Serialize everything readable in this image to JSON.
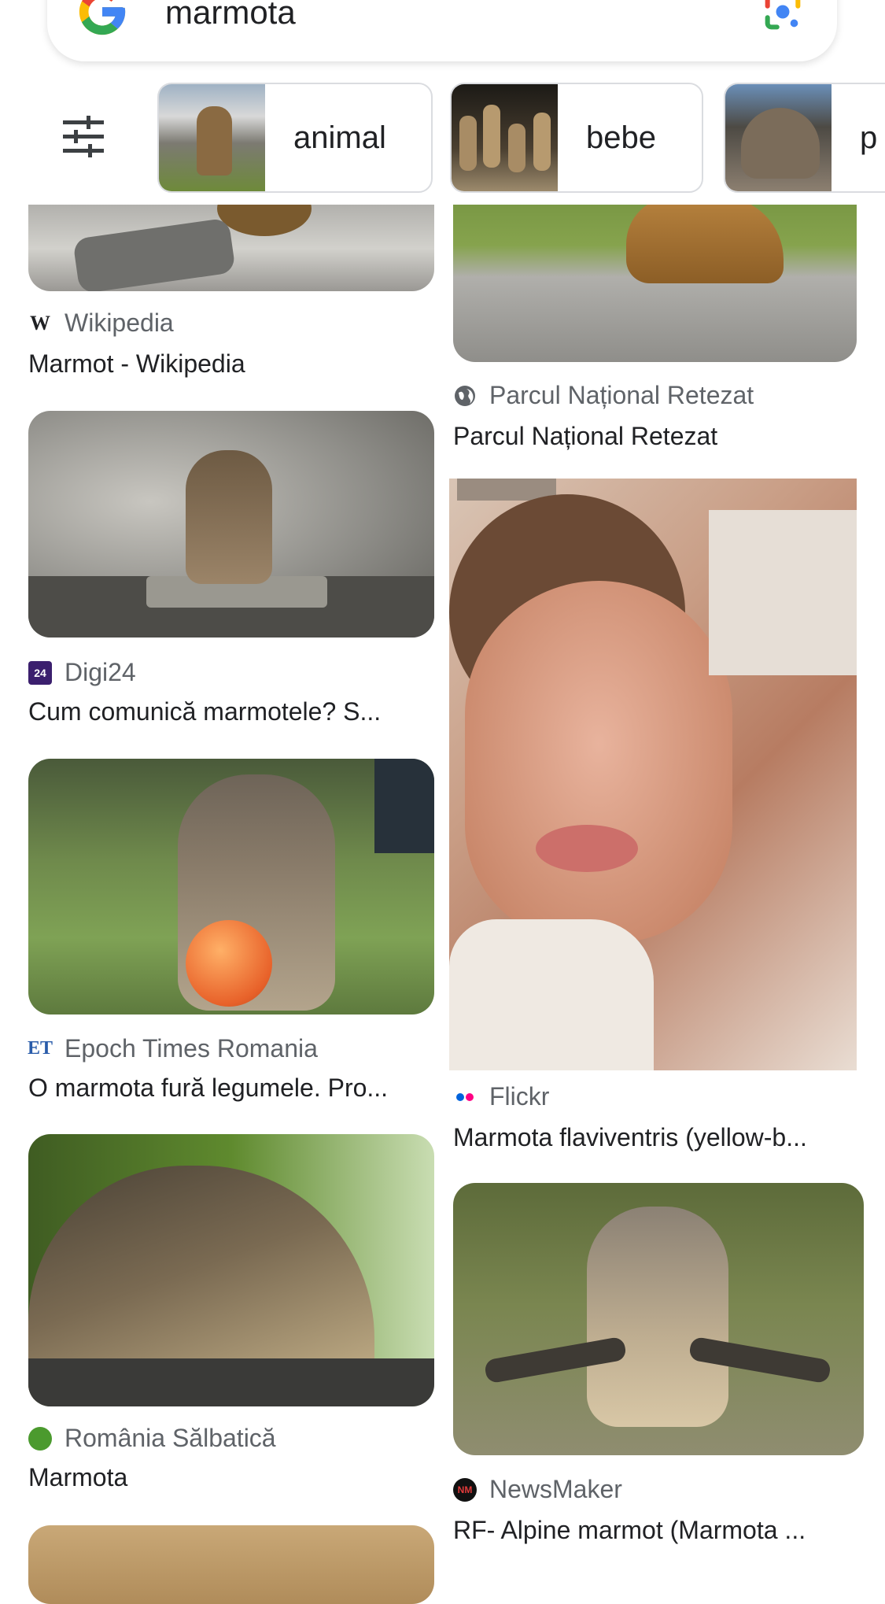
{
  "search": {
    "query": "marmota"
  },
  "chips": [
    {
      "label": "animal"
    },
    {
      "label": "bebe"
    },
    {
      "label": "p"
    }
  ],
  "results": {
    "left": [
      {
        "source": "Wikipedia",
        "title": "Marmot - Wikipedia",
        "source_icon": "wikipedia-icon"
      },
      {
        "source": "Digi24",
        "title": "Cum comunică marmotele? S...",
        "source_icon": "digi24-icon"
      },
      {
        "source": "Epoch Times Romania",
        "title": "O marmota fură legumele. Pro...",
        "source_icon": "epoch-times-icon"
      },
      {
        "source": "România Sălbatică",
        "title": "Marmota",
        "source_icon": "romania-salbatica-icon"
      }
    ],
    "right": [
      {
        "source": "Parcul Național Retezat",
        "title": "Parcul Național Retezat",
        "source_icon": "globe-icon"
      },
      {
        "source": "Flickr",
        "title": "Marmota flaviventris (yellow-b...",
        "source_icon": "flickr-icon"
      },
      {
        "source": "NewsMaker",
        "title": "RF- Alpine marmot (Marmota ...",
        "source_icon": "newsmaker-icon"
      }
    ]
  },
  "colors": {
    "google_blue": "#4285F4",
    "google_red": "#EA4335",
    "google_yellow": "#FBBC05",
    "google_green": "#34A853",
    "flickr_blue": "#0063dc",
    "flickr_pink": "#ff0084"
  }
}
